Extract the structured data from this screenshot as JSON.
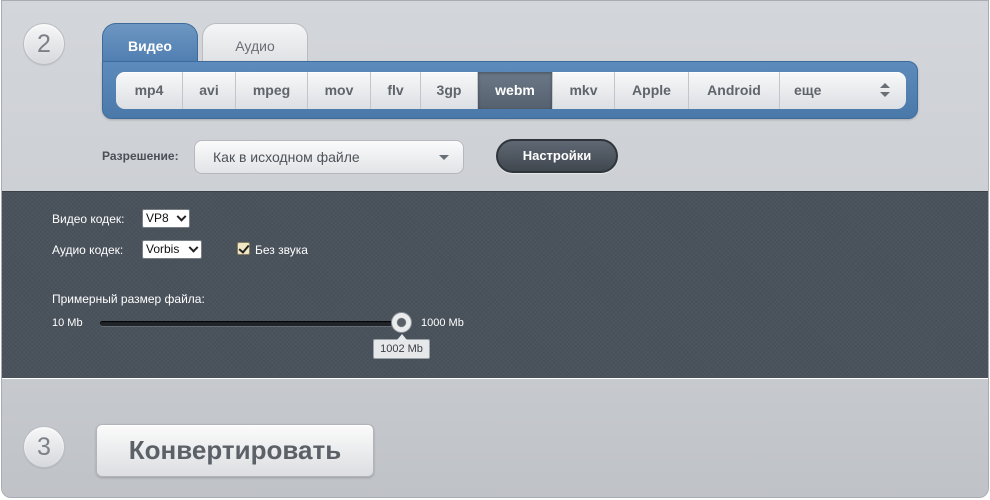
{
  "steps": {
    "step2": "2",
    "step3": "3"
  },
  "tabs": [
    {
      "label": "Видео",
      "active": true
    },
    {
      "label": "Аудио",
      "active": false
    }
  ],
  "formats": [
    {
      "label": "mp4"
    },
    {
      "label": "avi"
    },
    {
      "label": "mpeg"
    },
    {
      "label": "mov"
    },
    {
      "label": "flv"
    },
    {
      "label": "3gp"
    },
    {
      "label": "webm",
      "active": true
    },
    {
      "label": "mkv"
    },
    {
      "label": "Apple"
    },
    {
      "label": "Android"
    },
    {
      "label": "еще"
    }
  ],
  "resolution": {
    "label": "Разрешение:",
    "value": "Как в исходном файле"
  },
  "settings_button": "Настройки",
  "settings": {
    "video_codec_label": "Видео кодек:",
    "video_codec_value": "VP8",
    "audio_codec_label": "Аудио кодек:",
    "audio_codec_value": "Vorbis",
    "no_sound_label": "Без звука",
    "no_sound_checked": true,
    "file_size_label": "Примерный размер файла:",
    "slider_min_label": "10 Mb",
    "slider_max_label": "1000 Mb",
    "slider_value_label": "1002 Mb",
    "slider_value_fraction": 1.0
  },
  "convert_button": "Конвертировать",
  "colors": {
    "accent": "#5581b3",
    "dark_panel": "#4a525c",
    "active_format": "#5e6a78"
  }
}
